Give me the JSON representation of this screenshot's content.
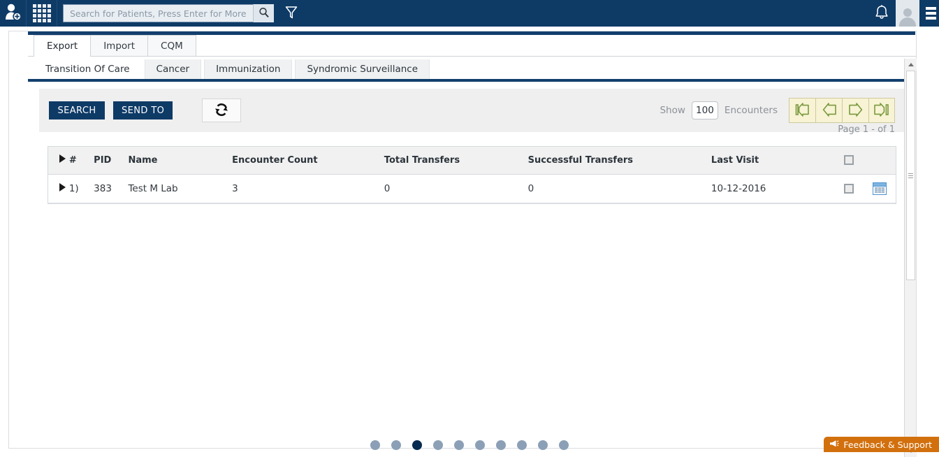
{
  "header": {
    "add_patient_icon": "add-user-icon",
    "apps_icon": "apps-grid-icon",
    "search": {
      "placeholder": "Search for Patients, Press Enter for More",
      "value": "",
      "button_icon": "search-icon"
    },
    "filter_icon": "filter-funnel-icon",
    "notifications_icon": "bell-icon",
    "avatar_icon": "user-avatar-icon",
    "menu_icon": "menu-bars-icon"
  },
  "primary_tabs": [
    {
      "label": "Export",
      "active": true
    },
    {
      "label": "Import",
      "active": false
    },
    {
      "label": "CQM",
      "active": false
    }
  ],
  "secondary_tabs": [
    {
      "label": "Transition Of Care",
      "active": true
    },
    {
      "label": "Cancer",
      "active": false
    },
    {
      "label": "Immunization",
      "active": false
    },
    {
      "label": "Syndromic Surveillance",
      "active": false
    }
  ],
  "toolbar": {
    "search_label": "SEARCH",
    "send_to_label": "SEND TO",
    "refresh_icon": "refresh-icon",
    "show_label": "Show",
    "count_value": "100",
    "count_placeholder": "",
    "encounters_label": "Encounters",
    "pager": {
      "first_icon": "first-page-icon",
      "prev_icon": "previous-page-icon",
      "next_icon": "next-page-icon",
      "last_icon": "last-page-icon",
      "page_info": "Page 1 - of 1"
    }
  },
  "table": {
    "columns": [
      "",
      "#",
      "PID",
      "Name",
      "Encounter Count",
      "Total Transfers",
      "Successful Transfers",
      "Last Visit",
      "",
      ""
    ],
    "header_select_all_icon": "select-all-checkbox",
    "rows": [
      {
        "expand_icon": "expand-row-arrow",
        "index": "1)",
        "pid": "383",
        "name": "Test M Lab",
        "encounter_count": "3",
        "total_transfers": "0",
        "successful_transfers": "0",
        "last_visit": "10-12-2016",
        "select_icon": "row-checkbox",
        "action_icon": "grid-view-icon"
      }
    ]
  },
  "carousel": {
    "total": 10,
    "active_index": 2
  },
  "feedback": {
    "label": "Feedback & Support",
    "icon": "megaphone-icon"
  },
  "scrollbar": {
    "up_icon": "scroll-up-arrow",
    "down_icon": "scroll-down-arrow"
  },
  "colors": {
    "brand_navy": "#0e3a66",
    "panel_navy": "#123f6d",
    "pager_cream": "#f7f3d4",
    "pager_green": "#7a9a3f",
    "feedback_orange": "#d2700d",
    "dot_active": "#062b50",
    "dot_inactive": "#8ba0b6"
  }
}
